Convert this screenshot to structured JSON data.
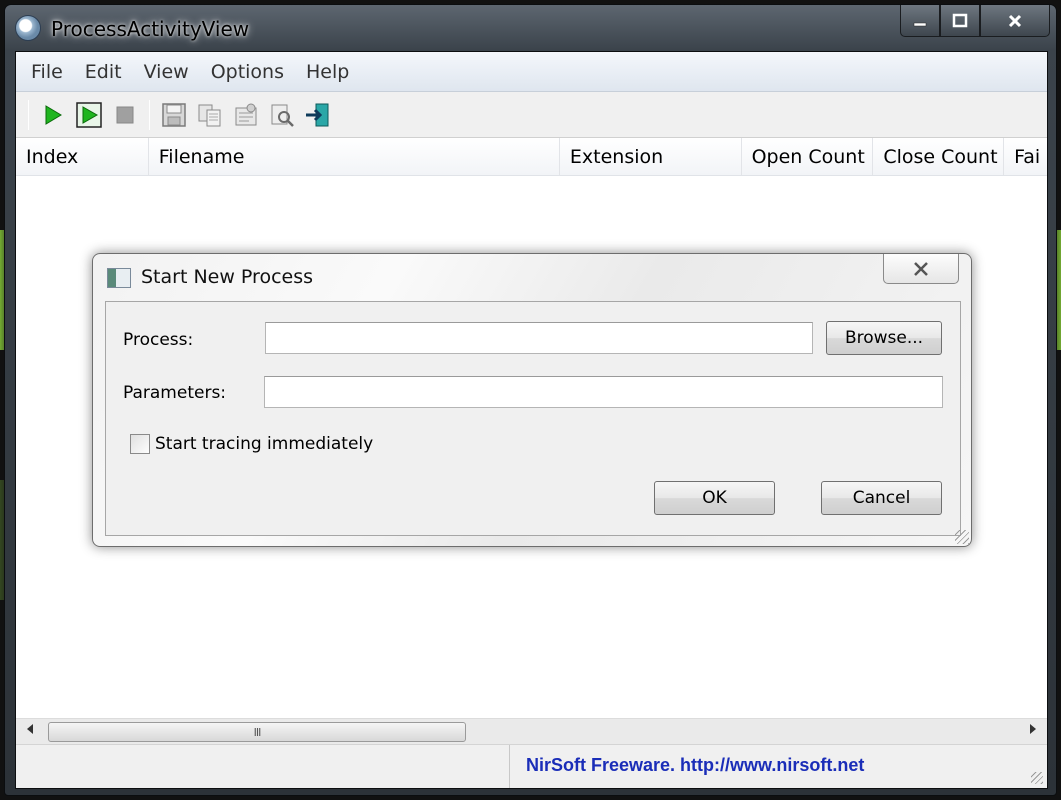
{
  "window": {
    "title": "ProcessActivityView",
    "minimize_label": "▁",
    "maximize_label": "□",
    "close_label": "✕"
  },
  "menu": {
    "items": [
      "File",
      "Edit",
      "View",
      "Options",
      "Help"
    ]
  },
  "toolbar": {
    "icons": [
      "play-icon",
      "play-trace-icon",
      "stop-icon",
      "save-icon",
      "copy-icon",
      "properties-icon",
      "find-icon",
      "exit-icon"
    ]
  },
  "table": {
    "columns": [
      "Index",
      "Filename",
      "Extension",
      "Open Count",
      "Close Count",
      "Fai"
    ]
  },
  "scrollbar": {
    "thumb_grip": "III"
  },
  "status": {
    "link": "NirSoft Freeware.  http://www.nirsoft.net"
  },
  "dialog": {
    "title": "Start New Process",
    "close_label": "✕",
    "process_label": "Process:",
    "process_value": "",
    "browse_label": "Browse...",
    "parameters_label": "Parameters:",
    "parameters_value": "",
    "checkbox_label": "Start tracing immediately",
    "checkbox_checked": false,
    "ok_label": "OK",
    "cancel_label": "Cancel"
  },
  "colors": {
    "status_link": "#1a2db8",
    "play_green": "#1fb51f"
  }
}
